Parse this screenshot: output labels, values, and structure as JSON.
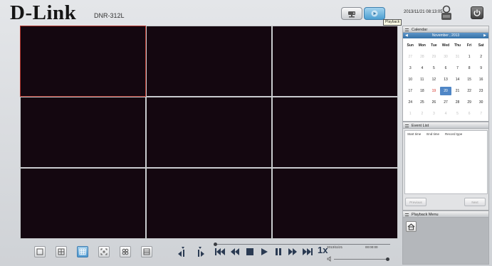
{
  "header": {
    "logo": "D-Link",
    "model": "DNR-312L",
    "tooltip": "Playback",
    "datetime": "2013/11/21  08:13:05"
  },
  "calendar": {
    "title": "Calendar",
    "month": "November , 2013",
    "weekdays": [
      "Sun",
      "Mon",
      "Tue",
      "Wed",
      "Thu",
      "Fri",
      "Sat"
    ],
    "weeks": [
      [
        "27",
        "28",
        "29",
        "30",
        "31",
        "1",
        "2"
      ],
      [
        "3",
        "4",
        "5",
        "6",
        "7",
        "8",
        "9"
      ],
      [
        "10",
        "11",
        "12",
        "13",
        "14",
        "15",
        "16"
      ],
      [
        "17",
        "18",
        "19",
        "20",
        "21",
        "22",
        "23"
      ],
      [
        "24",
        "25",
        "26",
        "27",
        "28",
        "29",
        "30"
      ],
      [
        "1",
        "2",
        "3",
        "4",
        "5",
        "6",
        "7"
      ]
    ],
    "selected_day": "20",
    "highlight_day": "19"
  },
  "event_list": {
    "title": "Event List",
    "columns": [
      "Start time",
      "End time",
      "Record type"
    ],
    "previous_label": "Previous",
    "next_label": "Next"
  },
  "playback_menu": {
    "title": "Playback Menu"
  },
  "toolbar": {
    "speed": "1x",
    "date": "2013/11/21",
    "time": "00:00:00"
  },
  "colors": {
    "accent_blue": "#4f86c6",
    "selected_border": "#b3352c",
    "video_bg": "#140710"
  }
}
